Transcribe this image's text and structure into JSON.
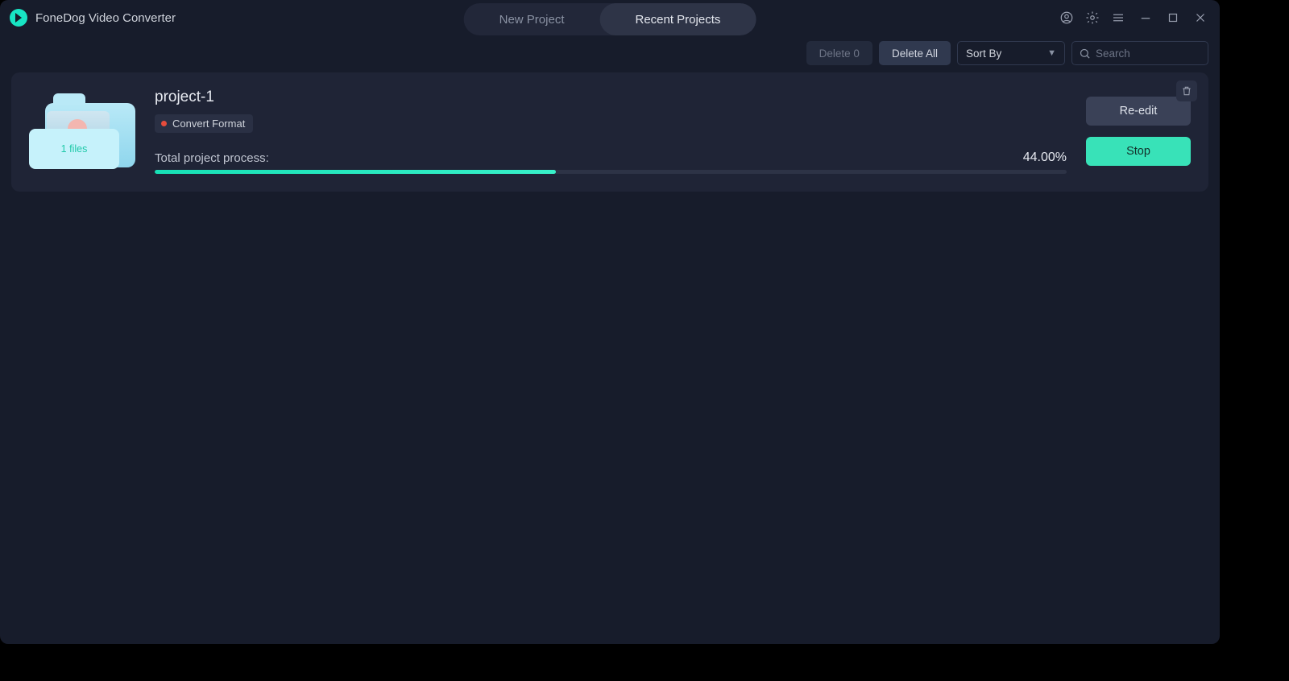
{
  "app": {
    "title": "FoneDog Video Converter"
  },
  "tabs": {
    "new_project": "New Project",
    "recent_projects": "Recent Projects"
  },
  "toolbar": {
    "delete_count_label": "Delete 0",
    "delete_all_label": "Delete All",
    "sort_by_label": "Sort By",
    "search_placeholder": "Search"
  },
  "project": {
    "name": "project-1",
    "badge": "Convert Format",
    "files_label": "1 files",
    "process_label": "Total project process:",
    "progress_percent": 44.0,
    "progress_text": "44.00%",
    "reedit_label": "Re-edit",
    "stop_label": "Stop"
  }
}
